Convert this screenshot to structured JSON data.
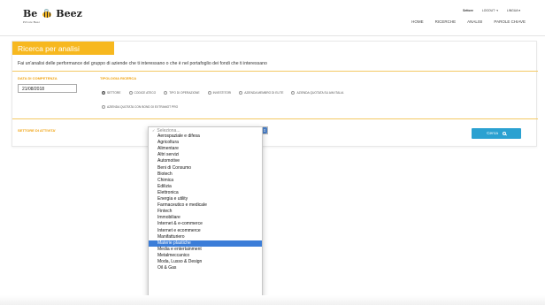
{
  "brand": {
    "logo_left": "Be",
    "logo_right": "Beez",
    "tagline": "Private Beez"
  },
  "top_links": {
    "user": "Settore",
    "logout": "LOGOUT",
    "lingua": "LINGUA"
  },
  "nav": [
    "HOME",
    "RICERCHE",
    "ANALISI",
    "PAROLE CHIAVE"
  ],
  "card": {
    "title": "Ricerca per analisi",
    "description": "Fai un'analisi delle performance del gruppo di aziende che ti interessano o che è nel portafoglio dei fondi che ti interessano"
  },
  "data_competenza": {
    "label": "DATA DI COMPETENZA",
    "value": "21/08/2018"
  },
  "tipologia": {
    "label": "TIPOLOGIA RICERCA",
    "options_row1": [
      "SETTORE",
      "CODICE ATECO",
      "TIPO DI OPERAZIONE",
      "INVESTITORI",
      "AZIENDA MEMBRO DI ELITE",
      "AZIENDA QUOTATA SU AIM ITALIA"
    ],
    "options_row2": [
      "AZIENDA QUOTATA CON BOND DI EXTRAMOT PRO"
    ],
    "selected": "SETTORE"
  },
  "settore": {
    "label": "SETTORE DI ATTIVITA'",
    "placeholder": "Seleziona...",
    "options": [
      "Aerospaziale e difesa",
      "Agricoltura",
      "Alimentare",
      "Altri servizi",
      "Automotive",
      "Beni di Consumo",
      "Biotech",
      "Chimica",
      "Edilizia",
      "Elettronica",
      "Energia e utility",
      "Farmaceutico e medicale",
      "Fintech",
      "Immobiliare",
      "Internet & e-commerce",
      "Internet e ecommerce",
      "Manifatturiero",
      "Materie plastiche",
      "Media e entertainment",
      "Metalmeccanico",
      "Moda, Lusso & Design",
      "Oil & Gas"
    ],
    "highlighted": "Materie plastiche",
    "more_indicator": "▼"
  },
  "search_button": {
    "label": "Cerca"
  },
  "colors": {
    "accent": "#f7b81f",
    "button": "#2ba1d1",
    "highlight": "#3b7dd8"
  }
}
